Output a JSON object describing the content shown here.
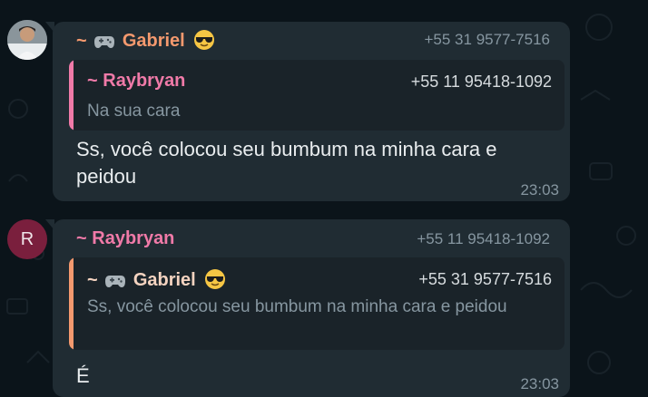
{
  "colors": {
    "background": "#0b141a",
    "bubble": "#202c33",
    "quote_bg": "#1a2329",
    "sender_gabriel": "#f4996e",
    "sender_raybryan": "#f07aa8",
    "secondary_text": "#8696a0",
    "primary_text": "#e9edef"
  },
  "messages": [
    {
      "avatar": {
        "type": "photo"
      },
      "sender": {
        "prefix": "~",
        "name": "Gabriel",
        "icons": [
          "gamepad-icon",
          "sunglasses-emoji"
        ]
      },
      "phone": "+55 31 9577-7516",
      "quote": {
        "sender": {
          "prefix": "~",
          "name": "Raybryan"
        },
        "phone": "+55 11 95418-1092",
        "text": "Na sua cara"
      },
      "text": "Ss, você colocou seu bumbum na minha cara e peidou",
      "time": "23:03"
    },
    {
      "avatar": {
        "type": "letter",
        "letter": "R"
      },
      "sender": {
        "prefix": "~",
        "name": "Raybryan"
      },
      "phone": "+55 11 95418-1092",
      "quote": {
        "sender": {
          "prefix": "~",
          "name": "Gabriel",
          "icons": [
            "gamepad-icon",
            "sunglasses-emoji"
          ]
        },
        "phone": "+55 31 9577-7516",
        "text": "Ss, você colocou seu bumbum na minha cara e peidou"
      },
      "text": "É",
      "time": "23:03"
    }
  ]
}
